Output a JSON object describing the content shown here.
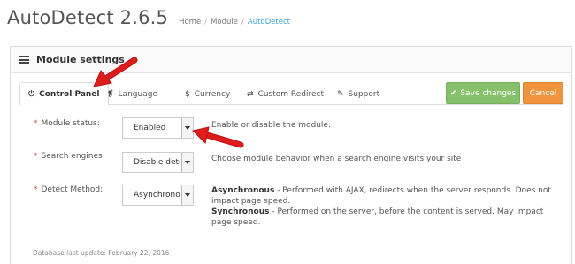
{
  "app": {
    "title": "AutoDetect 2.6.5",
    "breadcrumb": [
      "Home",
      "Module",
      "AutoDetect"
    ]
  },
  "panel": {
    "icon": "list-icon",
    "title": "Module settings"
  },
  "tabs": [
    {
      "label": "Control Panel",
      "icon": "power-icon",
      "active": true
    },
    {
      "label": "Language",
      "icon": "translate-icon"
    },
    {
      "label": "Currency",
      "icon": "dollar-icon"
    },
    {
      "label": "Custom Redirect",
      "icon": "exchange-icon"
    },
    {
      "label": "Support",
      "icon": "wrench-icon"
    }
  ],
  "actions": {
    "save_label": "Save changes",
    "cancel_label": "Cancel"
  },
  "form": {
    "module_status": {
      "label": "Module status:",
      "value": "Enabled",
      "help": "Enable or disable the module."
    },
    "search_engines": {
      "label": "Search engines",
      "value": "Disable detection",
      "help": "Choose module behavior when a search engine visits your site"
    },
    "detect_method": {
      "label": "Detect Method:",
      "value": "Asynchronous",
      "help_async_title": "Asynchronous",
      "help_async_text": " - Performed with AJAX, redirects when the server responds. Does not impact page speed.",
      "help_sync_title": "Synchronous",
      "help_sync_text": " - Performed on the server, before the content is served. May impact page speed."
    }
  },
  "footer": {
    "last_update": "Database last update: February 22, 2016"
  },
  "colors": {
    "save": "#86c06b",
    "cancel": "#f0953e",
    "link": "#3aa1d8",
    "required": "#d9534f",
    "annotation_arrow": "#e01b1b"
  }
}
